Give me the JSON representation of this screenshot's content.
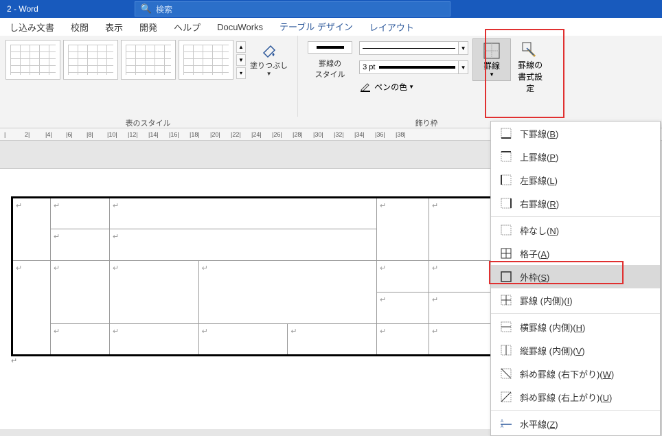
{
  "title": "2 - Word",
  "search_placeholder": "検索",
  "menu": {
    "items": [
      "し込み文書",
      "校閲",
      "表示",
      "開発",
      "ヘルプ",
      "DocuWorks",
      "テーブル デザイン",
      "レイアウト"
    ],
    "active_index": 6
  },
  "ribbon": {
    "table_styles_label": "表のスタイル",
    "fill_label": "塗りつぶし",
    "border_style_label": "罫線の\nスタイル",
    "pen_width": "3 pt",
    "pen_color_label": "ペンの色",
    "borders_label": "罫線",
    "painter_label": "罫線の\n書式設定",
    "decoration_label": "飾り枠"
  },
  "ruler_marks": [
    "|",
    "2|",
    "|4|",
    "|6|",
    "|8|",
    "|10|",
    "|12|",
    "|14|",
    "|16|",
    "|18|",
    "|20|",
    "|22|",
    "|24|",
    "|26|",
    "|28|",
    "|30|",
    "|32|",
    "|34|",
    "|36|",
    "|38|"
  ],
  "borders_menu": [
    {
      "label": "下罫線",
      "key": "B",
      "icon": "bottom"
    },
    {
      "label": "上罫線",
      "key": "P",
      "icon": "top"
    },
    {
      "label": "左罫線",
      "key": "L",
      "icon": "left"
    },
    {
      "label": "右罫線",
      "key": "R",
      "icon": "right"
    },
    {
      "sep": true
    },
    {
      "label": "枠なし",
      "key": "N",
      "icon": "none"
    },
    {
      "label": "格子",
      "key": "A",
      "icon": "all"
    },
    {
      "label": "外枠",
      "key": "S",
      "icon": "outside",
      "selected": true
    },
    {
      "label": "罫線 (内側)",
      "key": "I",
      "icon": "inside"
    },
    {
      "sep": true
    },
    {
      "label": "横罫線 (内側)",
      "key": "H",
      "icon": "insideH"
    },
    {
      "label": "縦罫線 (内側)",
      "key": "V",
      "icon": "insideV"
    },
    {
      "label": "斜め罫線 (右下がり)",
      "key": "W",
      "icon": "diagDown"
    },
    {
      "label": "斜め罫線 (右上がり)",
      "key": "U",
      "icon": "diagUp"
    },
    {
      "sep": true
    },
    {
      "label": "水平線",
      "key": "Z",
      "icon": "horiz"
    }
  ]
}
